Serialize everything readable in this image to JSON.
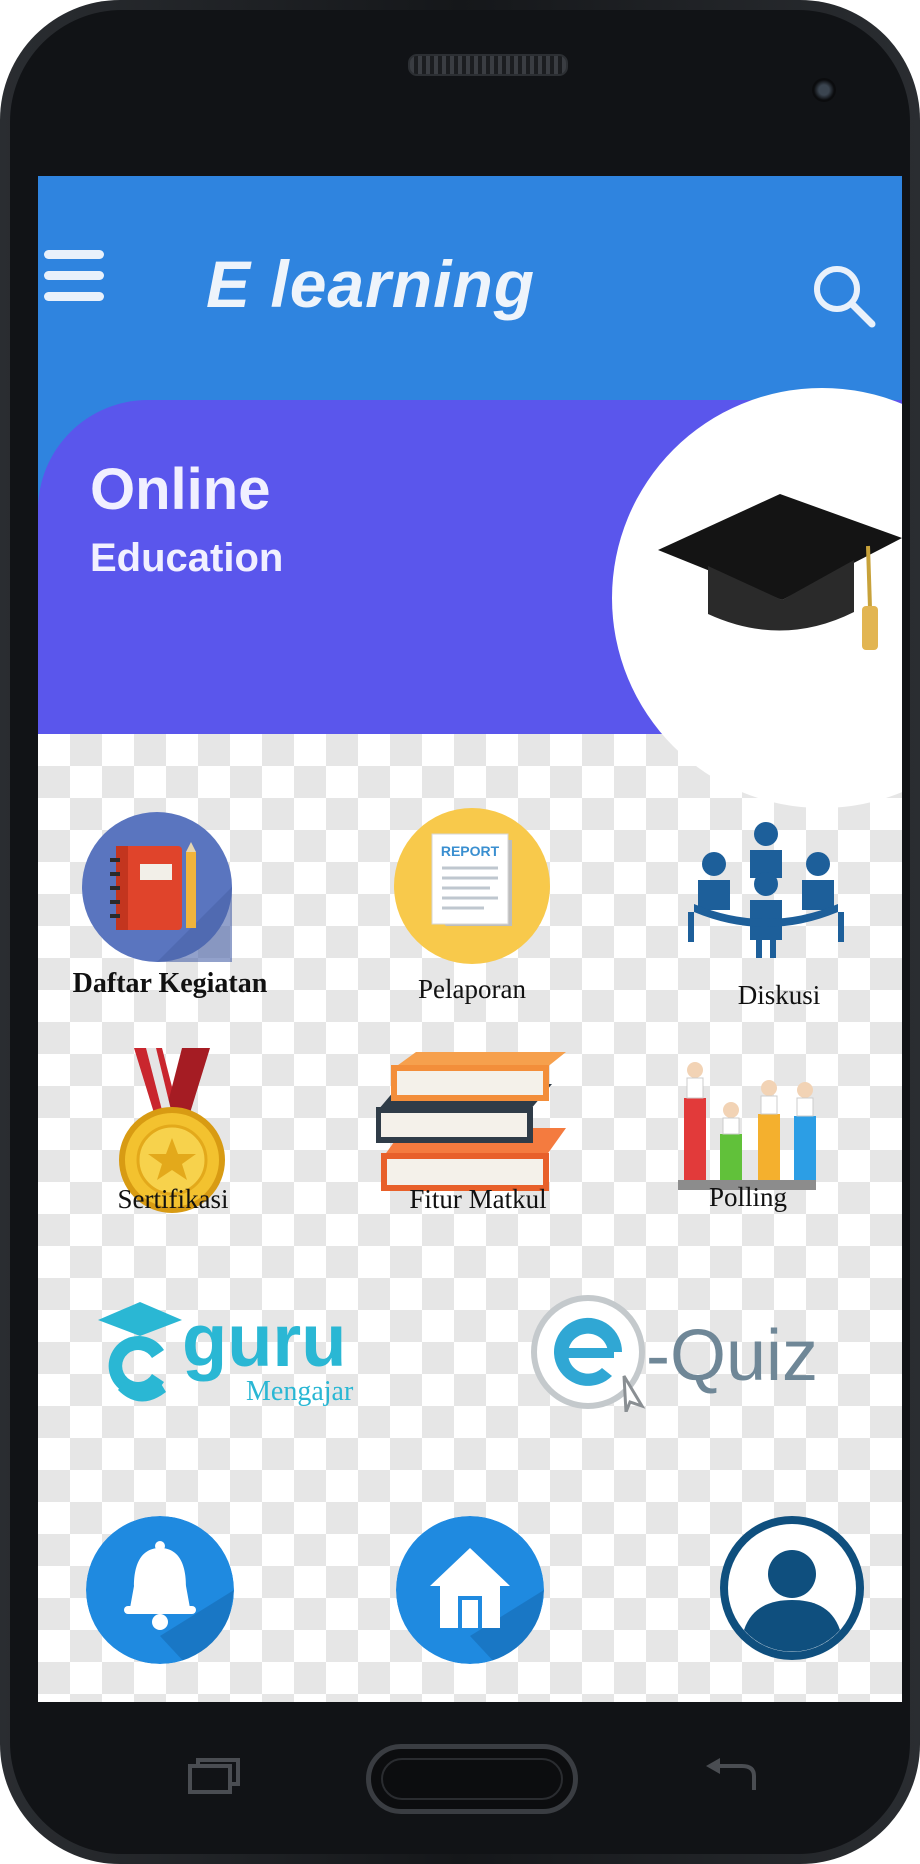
{
  "app": {
    "title": "E learning"
  },
  "banner": {
    "title": "Online",
    "subtitle": "Education"
  },
  "menu": [
    {
      "label": "Daftar Kegiatan",
      "icon": "planner-book-icon"
    },
    {
      "label": "Pelaporan",
      "icon": "report-document-icon"
    },
    {
      "label": "Diskusi",
      "icon": "discussion-meeting-icon"
    },
    {
      "label": "Sertifikasi",
      "icon": "medal-icon"
    },
    {
      "label": "Fitur Matkul",
      "icon": "books-stack-icon"
    },
    {
      "label": "Polling",
      "icon": "bar-chart-people-icon"
    }
  ],
  "logos": {
    "guru": {
      "main": "guru",
      "sub": "Mengajar"
    },
    "quiz": {
      "main": "-Quiz"
    }
  },
  "bottom_nav": [
    {
      "icon": "bell-icon"
    },
    {
      "icon": "home-icon"
    },
    {
      "icon": "profile-icon"
    }
  ],
  "colors": {
    "appbar": "#2f84df",
    "banner": "#5a56ec",
    "guru_teal": "#2ab7d4",
    "quiz_gray": "#6f8797",
    "nav_blue": "#1f8ae0",
    "nav_dark": "#0f4f7e"
  }
}
